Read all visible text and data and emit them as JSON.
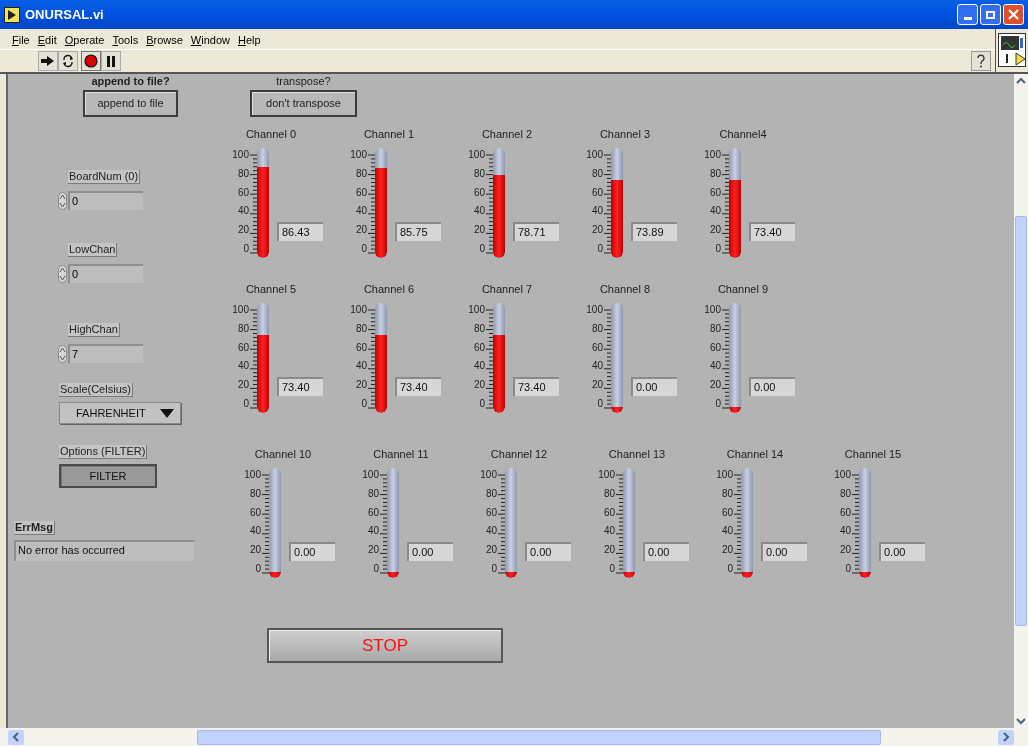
{
  "window": {
    "title": "ONURSAL.vi"
  },
  "menu": [
    "File",
    "Edit",
    "Operate",
    "Tools",
    "Browse",
    "Window",
    "Help"
  ],
  "append_to_file": {
    "label": "append to file?",
    "button": "append to file"
  },
  "transpose": {
    "label": "transpose?",
    "button": "don't transpose"
  },
  "board_num": {
    "label": "BoardNum (0)",
    "value": "0"
  },
  "low_chan": {
    "label": "LowChan",
    "value": "0"
  },
  "high_chan": {
    "label": "HighChan",
    "value": "7"
  },
  "scale": {
    "label": "Scale(Celsius)",
    "value": "FAHRENHEIT"
  },
  "options": {
    "label": "Options (FILTER)",
    "button": "FILTER"
  },
  "err_msg": {
    "label": "ErrMsg",
    "value": "No error has occurred"
  },
  "channel_rows": [
    [
      {
        "name": "Channel 0",
        "level": 0.8643,
        "reading": "86.43",
        "ticks": [
          "100",
          "80",
          "60",
          "40",
          "20",
          "0"
        ]
      },
      {
        "name": "Channel 1",
        "level": 0.8575,
        "reading": "85.75",
        "ticks": [
          "100",
          "80",
          "60",
          "40",
          "20",
          "0"
        ]
      },
      {
        "name": "Channel 2",
        "level": 0.7871,
        "reading": "78.71",
        "ticks": [
          "100",
          "80",
          "60",
          "40",
          "20",
          "0"
        ]
      },
      {
        "name": "Channel 3",
        "level": 0.7389,
        "reading": "73.89",
        "ticks": [
          "100",
          "80",
          "60",
          "40",
          "20",
          "0"
        ]
      },
      {
        "name": "Channel4",
        "level": 0.734,
        "reading": "73.40",
        "ticks": [
          "100",
          "80",
          "60",
          "40",
          "20",
          "0"
        ]
      }
    ],
    [
      {
        "name": "Channel 5",
        "level": 0.734,
        "reading": "73.40",
        "ticks": [
          "100",
          "80",
          "60",
          "40",
          "20",
          "0"
        ]
      },
      {
        "name": "Channel 6",
        "level": 0.734,
        "reading": "73.40",
        "ticks": [
          "100",
          "80",
          "60",
          "40",
          "20",
          "0"
        ]
      },
      {
        "name": "Channel 7",
        "level": 0.734,
        "reading": "73.40",
        "ticks": [
          "100",
          "80",
          "60",
          "40",
          "20",
          "0"
        ]
      },
      {
        "name": "Channel 8",
        "level": 0,
        "reading": "0.00",
        "ticks": [
          "100",
          "80",
          "60",
          "40",
          "20",
          "0"
        ]
      },
      {
        "name": "Channel 9",
        "level": 0,
        "reading": "0.00",
        "ticks": [
          "100",
          "80",
          "60",
          "40",
          "20",
          "0"
        ]
      }
    ],
    [
      {
        "name": "Channel 10",
        "level": 0,
        "reading": "0.00",
        "ticks": [
          "100",
          "80",
          "60",
          "40",
          "20",
          "0"
        ]
      },
      {
        "name": "Channel 11",
        "level": 0,
        "reading": "0.00",
        "ticks": [
          "100",
          "80",
          "60",
          "40",
          "20",
          "0"
        ]
      },
      {
        "name": "Channel 12",
        "level": 0,
        "reading": "0.00",
        "ticks": [
          "100",
          "80",
          "60",
          "40",
          "20",
          "0"
        ]
      },
      {
        "name": "Channel 13",
        "level": 0,
        "reading": "0.00",
        "ticks": [
          "100",
          "80",
          "60",
          "40",
          "20",
          "0"
        ]
      },
      {
        "name": "Channel 14",
        "level": 0,
        "reading": "0.00",
        "ticks": [
          "100",
          "80",
          "60",
          "40",
          "20",
          "0"
        ]
      },
      {
        "name": "Channel 15",
        "level": 0,
        "reading": "0.00",
        "ticks": [
          "100",
          "80",
          "60",
          "40",
          "20",
          "0"
        ]
      }
    ]
  ],
  "stop_button": "STOP"
}
